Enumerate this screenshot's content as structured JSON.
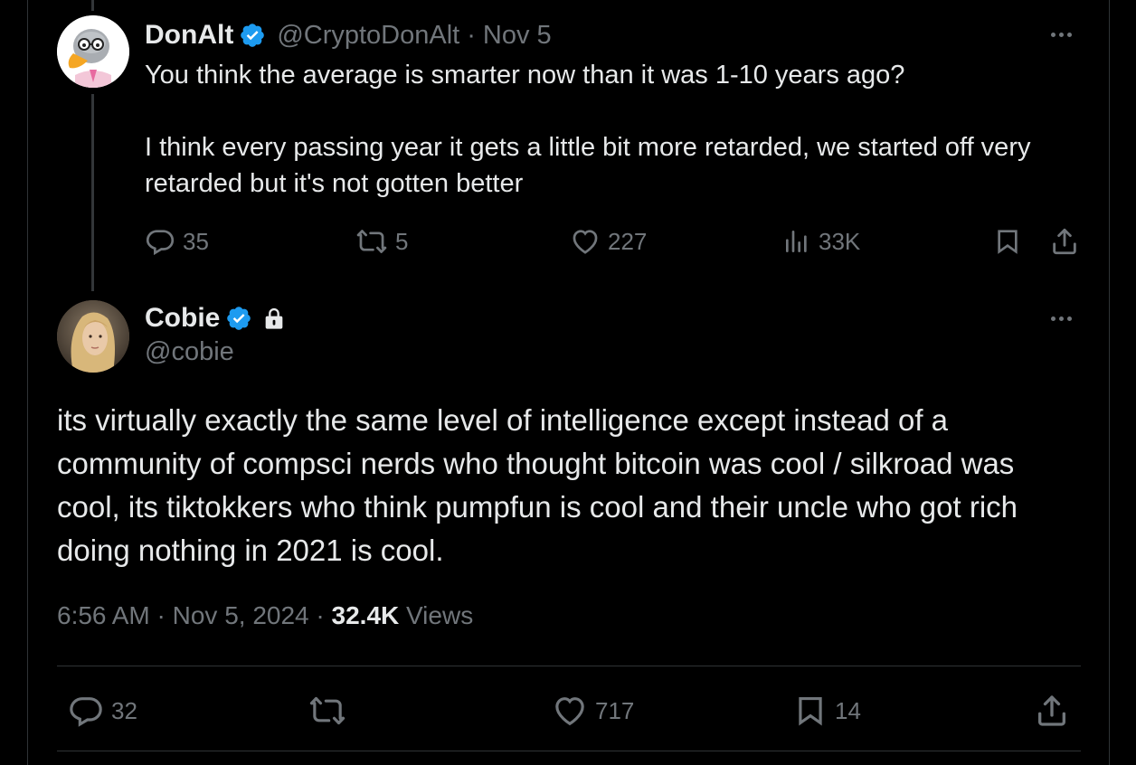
{
  "parent_tweet": {
    "display_name": "DonAlt",
    "handle": "@CryptoDonAlt",
    "separator": "·",
    "date": "Nov 5",
    "text_line1": "You think the average is smarter now than it was 1-10 years ago?",
    "text_line2": "I think every passing year it gets a little bit more retarded, we started off very retarded but it's not gotten better",
    "replies": "35",
    "reposts": "5",
    "likes": "227",
    "views": "33K"
  },
  "main_tweet": {
    "display_name": "Cobie",
    "handle": "@cobie",
    "text": "its virtually exactly the same level of intelligence except instead of a community of compsci nerds who thought bitcoin was cool / silkroad was cool, its tiktokkers who think pumpfun is cool and their uncle who got rich doing nothing in 2021 is cool.",
    "time": "6:56 AM",
    "separator": "·",
    "date": "Nov 5, 2024",
    "views_count": "32.4K",
    "views_label": "Views",
    "replies": "32",
    "likes": "717",
    "bookmarks": "14"
  },
  "colors": {
    "background": "#000000",
    "text_primary": "#e7e9ea",
    "text_secondary": "#71767b",
    "verified_blue": "#1d9bf0",
    "border": "#2f3336"
  },
  "icons": [
    "reply-icon",
    "repost-icon",
    "like-icon",
    "views-icon",
    "bookmark-icon",
    "share-icon",
    "verified-icon",
    "lock-icon",
    "more-icon"
  ]
}
